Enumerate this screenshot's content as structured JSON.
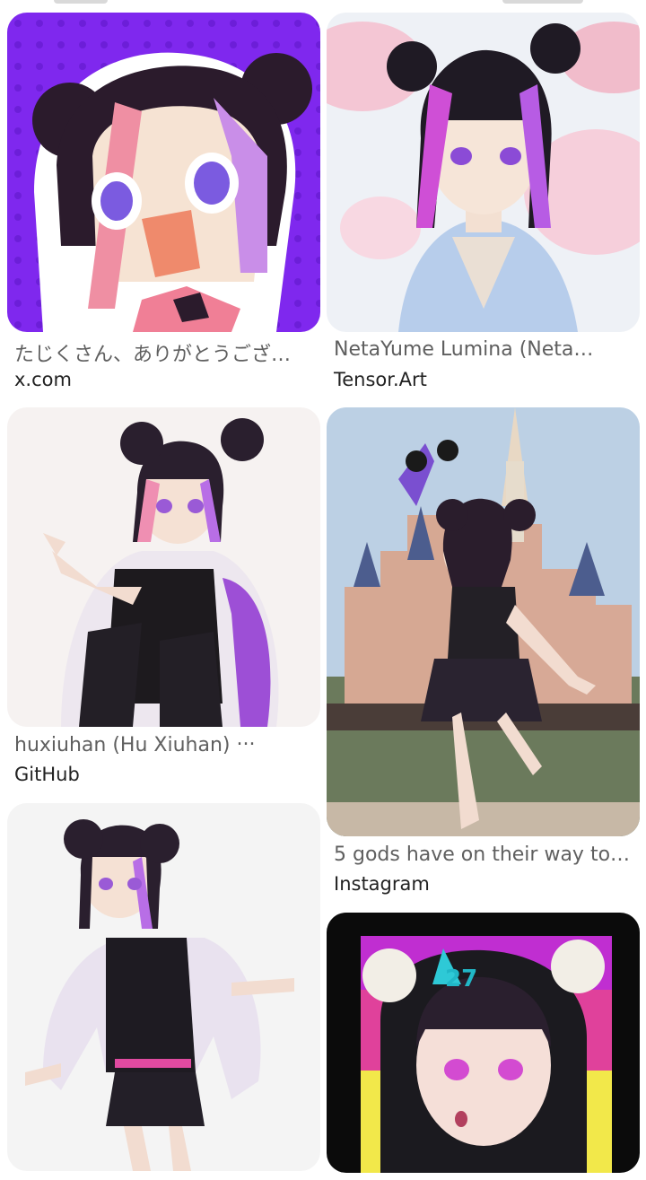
{
  "results": [
    {
      "title": "たじくさん、ありがとうござ…",
      "source": "x.com",
      "image": "chibi-anime-girl-purple-background"
    },
    {
      "title": "NetaYume Lumina (Neta…",
      "source": "Tensor.Art",
      "image": "anime-girl-cherry-blossoms"
    },
    {
      "title": "huxiuhan (Hu Xiuhan) ‧‧‧",
      "source": "GitHub",
      "image": "anime-girl-sitting-jacket"
    },
    {
      "title": "5 gods have on their way to…",
      "source": "Instagram",
      "image": "anime-girl-castle-mouse-ears"
    },
    {
      "title": "",
      "source": "",
      "image": "anime-girl-standing-jacket"
    },
    {
      "title": "",
      "source": "",
      "image": "anime-girl-neon-poster"
    }
  ],
  "colors": {
    "accent": "#7a22e8",
    "title_text": "#5f5f5f",
    "source_text": "#222222"
  }
}
